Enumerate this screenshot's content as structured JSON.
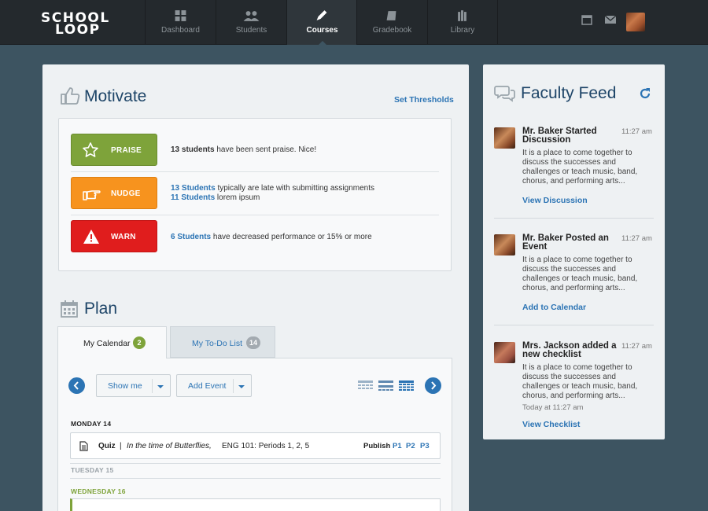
{
  "logo": {
    "line1": "SCHOOL",
    "line2": "LOOP"
  },
  "nav": {
    "tabs": [
      {
        "label": "Dashboard",
        "icon": "grid-icon"
      },
      {
        "label": "Students",
        "icon": "users-icon"
      },
      {
        "label": "Courses",
        "icon": "pencil-icon",
        "active": true
      },
      {
        "label": "Gradebook",
        "icon": "book-icon"
      },
      {
        "label": "Library",
        "icon": "library-icon"
      }
    ],
    "right_icons": [
      "calendar-icon",
      "mail-icon",
      "avatar"
    ]
  },
  "motivate": {
    "title": "Motivate",
    "set_thresholds": "Set Thresholds",
    "rows": [
      {
        "button": "PRAISE",
        "color": "#7ea33a",
        "text_bold": "13 students",
        "text_rest": " have been sent praise. Nice!"
      },
      {
        "button": "NUDGE",
        "color": "#f7931e",
        "line1_link": "13 Students",
        "line1_rest": " typically are late with submitting assignments",
        "line2_link": "11 Students",
        "line2_rest": " lorem ipsum"
      },
      {
        "button": "WARN",
        "color": "#e01d1d",
        "link": "6 Students",
        "text_rest": " have decreased performance or 15% or more"
      }
    ]
  },
  "plan": {
    "title": "Plan",
    "tabs": [
      {
        "label": "My Calendar",
        "count": "2",
        "badge_color": "#7ea33a"
      },
      {
        "label": "My To-Do List",
        "count": "14",
        "badge_color": "#a3aab0"
      }
    ],
    "show_me": "Show me",
    "add_event": "Add Event",
    "days": [
      {
        "label": "MONDAY 14",
        "color": "#222222"
      },
      {
        "label": "TUESDAY 15",
        "color": "#9aa2a8"
      },
      {
        "label": "WEDNESDAY 16",
        "color": "#7ea33a"
      }
    ],
    "event": {
      "type": "Quiz",
      "separator": "|",
      "title": "In the time of Butterflies,",
      "course": "ENG 101: Periods 1, 2, 5",
      "publish": "Publish",
      "periods": [
        "P1",
        "P2",
        "P3"
      ]
    }
  },
  "feed": {
    "title": "Faculty Feed",
    "items": [
      {
        "name": "Mr. Baker Started Discussion",
        "time": "11:27 am",
        "body": "It is a place to come together to discuss the successes and challenges or teach music, band, chorus, and performing arts...",
        "link": "View Discussion"
      },
      {
        "name": "Mr. Baker Posted an Event",
        "time": "11:27 am",
        "body": "It is a place to come together to discuss the successes and challenges or teach music, band, chorus, and performing arts...",
        "link": "Add to Calendar"
      },
      {
        "name": "Mrs. Jackson added a new checklist",
        "time": "11:27 am",
        "body": "It is a place to come together to discuss the successes and challenges or teach music, band, chorus, and performing arts...",
        "meta": "Today at 11:27 am",
        "link": "View Checklist"
      }
    ]
  }
}
